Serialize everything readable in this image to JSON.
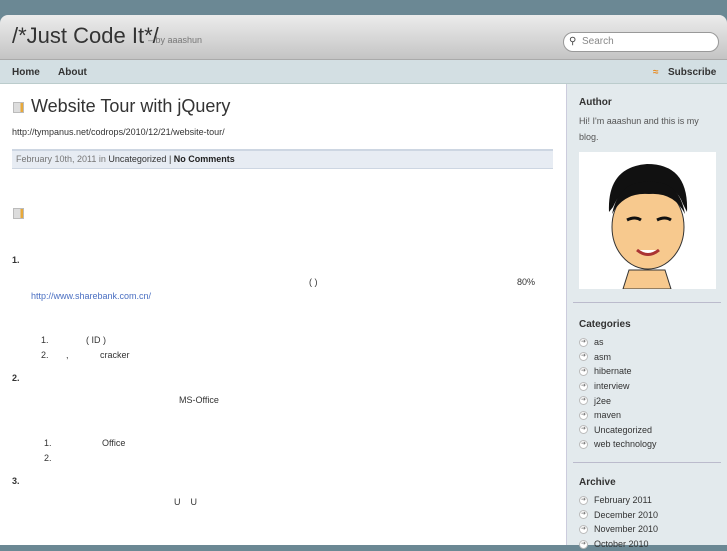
{
  "header": {
    "title": "/*Just Code It*/",
    "byline": "– by aaashun",
    "search_placeholder": "Search"
  },
  "nav": {
    "items": [
      "Home",
      "About"
    ],
    "subscribe": "Subscribe"
  },
  "post": {
    "title": "Website Tour with jQuery",
    "url": "http://tympanus.net/codrops/2010/12/21/website-tour/",
    "date": "February 10th, 2011 in ",
    "category": "Uncategorized",
    "sep": " | ",
    "comments": "No Comments",
    "body": {
      "h1": "1.",
      "paren": "(    )",
      "pct": "80%",
      "link": "http://www.sharebank.com.cn/",
      "l1a": "1.",
      "l1b": "(     ID       )",
      "l2a": "2.",
      "l2b": ",",
      "l2c": "cracker",
      "h2": "2.",
      "msoffice": "MS-Office",
      "m1a": "1.",
      "m1b": "Office",
      "m2a": "2.",
      "h3": "3.",
      "uu": "U    U"
    }
  },
  "sidebar": {
    "author_title": "Author",
    "author_text": "Hi! I'm aaashun and this is my blog.",
    "categories_title": "Categories",
    "categories": [
      "as",
      "asm",
      "hibernate",
      "interview",
      "j2ee",
      "maven",
      "Uncategorized",
      "web technology"
    ],
    "archive_title": "Archive",
    "archive": [
      "February 2011",
      "December 2010",
      "November 2010",
      "October 2010"
    ]
  }
}
